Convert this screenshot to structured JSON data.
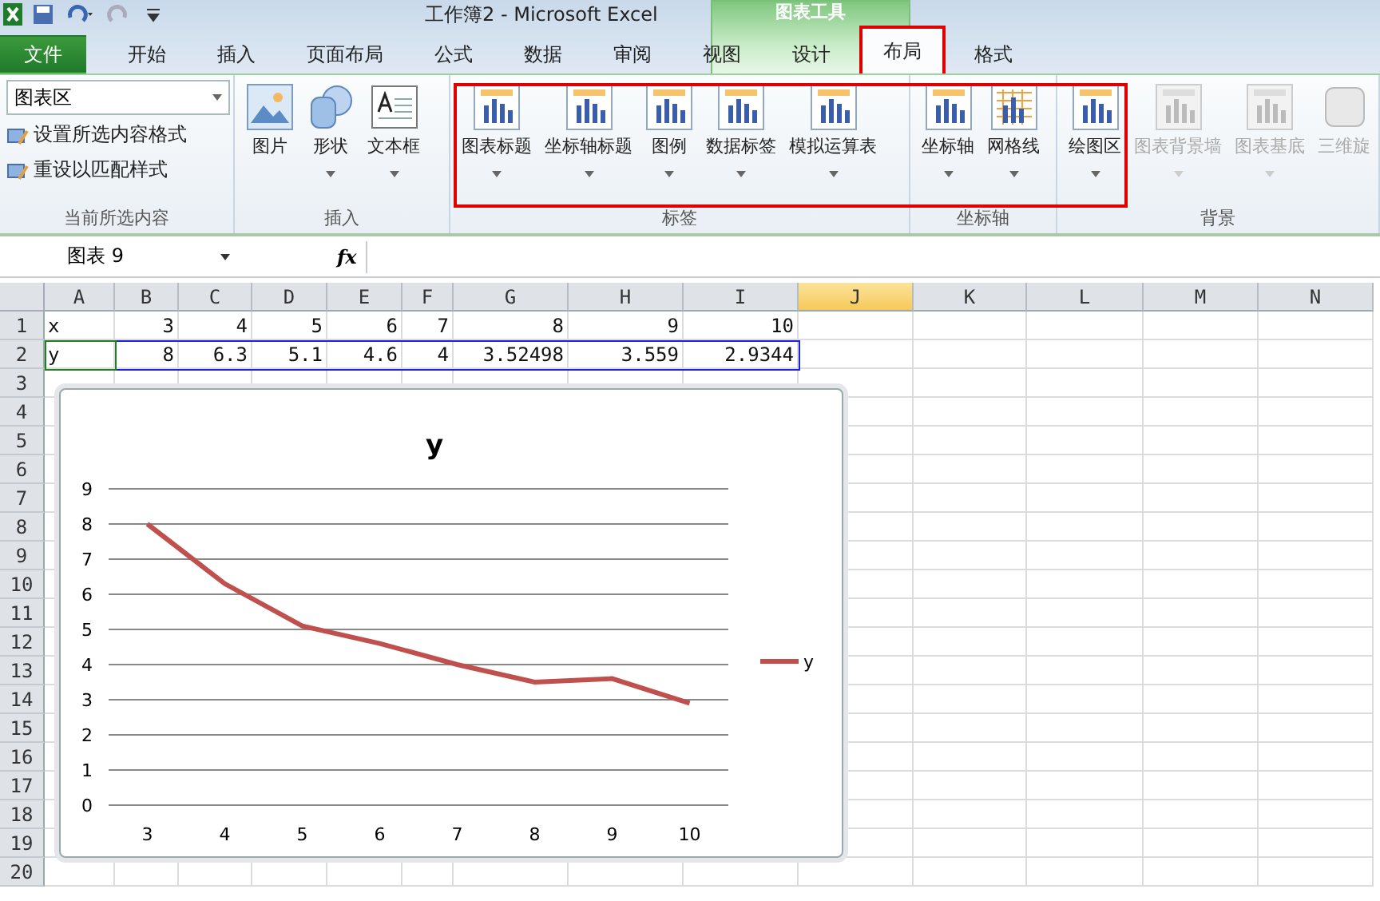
{
  "window": {
    "title": "工作簿2  -  Microsoft Excel",
    "context_group": "图表工具"
  },
  "tabs": [
    {
      "label": "文件",
      "kind": "file",
      "selected": false,
      "highlighted": false
    },
    {
      "label": "开始",
      "kind": "normal",
      "selected": false,
      "highlighted": false
    },
    {
      "label": "插入",
      "kind": "normal",
      "selected": false,
      "highlighted": false
    },
    {
      "label": "页面布局",
      "kind": "normal",
      "selected": false,
      "highlighted": false
    },
    {
      "label": "公式",
      "kind": "normal",
      "selected": false,
      "highlighted": false
    },
    {
      "label": "数据",
      "kind": "normal",
      "selected": false,
      "highlighted": false
    },
    {
      "label": "审阅",
      "kind": "normal",
      "selected": false,
      "highlighted": false
    },
    {
      "label": "视图",
      "kind": "normal",
      "selected": false,
      "highlighted": false
    },
    {
      "label": "设计",
      "kind": "context",
      "selected": false,
      "highlighted": false
    },
    {
      "label": "布局",
      "kind": "context",
      "selected": true,
      "highlighted": true
    },
    {
      "label": "格式",
      "kind": "context",
      "selected": false,
      "highlighted": false
    }
  ],
  "ribbon": {
    "highlight_box": true,
    "groups": [
      {
        "label": "当前所选内容",
        "selection": {
          "value": "图表区"
        },
        "actions": [
          {
            "label": "设置所选内容格式"
          },
          {
            "label": "重设以匹配样式"
          }
        ]
      },
      {
        "label": "插入",
        "items": [
          {
            "label": "图片",
            "dropdown": false,
            "disabled": false
          },
          {
            "label": "形状",
            "dropdown": true,
            "disabled": false
          },
          {
            "label": "文本框",
            "dropdown": true,
            "disabled": false
          }
        ]
      },
      {
        "label": "标签",
        "items": [
          {
            "label": "图表标题",
            "dropdown": true,
            "disabled": false
          },
          {
            "label": "坐标轴标题",
            "dropdown": true,
            "disabled": false
          },
          {
            "label": "图例",
            "dropdown": true,
            "disabled": false
          },
          {
            "label": "数据标签",
            "dropdown": true,
            "disabled": false
          },
          {
            "label": "模拟运算表",
            "dropdown": true,
            "disabled": false
          }
        ]
      },
      {
        "label": "坐标轴",
        "items": [
          {
            "label": "坐标轴",
            "dropdown": true,
            "disabled": false
          },
          {
            "label": "网格线",
            "dropdown": true,
            "disabled": false
          }
        ]
      },
      {
        "label": "背景",
        "items": [
          {
            "label": "绘图区",
            "dropdown": true,
            "disabled": false
          },
          {
            "label": "图表背景墙",
            "dropdown": true,
            "disabled": true
          },
          {
            "label": "图表基底",
            "dropdown": true,
            "disabled": true
          },
          {
            "label": "三维旋",
            "dropdown": false,
            "disabled": true
          }
        ]
      }
    ]
  },
  "formula_bar": {
    "name_box": "图表  9",
    "fx": "fx"
  },
  "sheet": {
    "columns": [
      {
        "label": "A",
        "selected": false
      },
      {
        "label": "B",
        "selected": false
      },
      {
        "label": "C",
        "selected": false
      },
      {
        "label": "D",
        "selected": false
      },
      {
        "label": "E",
        "selected": false
      },
      {
        "label": "F",
        "selected": false
      },
      {
        "label": "G",
        "selected": false
      },
      {
        "label": "H",
        "selected": false
      },
      {
        "label": "I",
        "selected": false
      },
      {
        "label": "J",
        "selected": true
      },
      {
        "label": "K",
        "selected": false
      },
      {
        "label": "L",
        "selected": false
      },
      {
        "label": "M",
        "selected": false
      },
      {
        "label": "N",
        "selected": false
      }
    ],
    "row_numbers": [
      "1",
      "2",
      "3",
      "4",
      "5",
      "6",
      "7",
      "8",
      "9",
      "10",
      "11",
      "12",
      "13",
      "14",
      "15",
      "16",
      "17",
      "18",
      "19",
      "20"
    ],
    "rows": [
      [
        "x",
        "3",
        "4",
        "5",
        "6",
        "7",
        "8",
        "9",
        "10"
      ],
      [
        "y",
        "8",
        "6.3",
        "5.1",
        "4.6",
        "4",
        "3.52498",
        "3.559",
        "2.9344"
      ]
    ]
  },
  "chart": {
    "chart_data": {
      "type": "line",
      "title": "y",
      "categories": [
        "3",
        "4",
        "5",
        "6",
        "7",
        "8",
        "9",
        "10"
      ],
      "series": [
        {
          "name": "y",
          "color": "#c0504d",
          "values": [
            8,
            6.3,
            5.1,
            4.6,
            4,
            3.5,
            3.6,
            2.9
          ]
        }
      ],
      "ylim": [
        0,
        9
      ],
      "yticks": [
        0,
        1,
        2,
        3,
        4,
        5,
        6,
        7,
        8,
        9
      ],
      "grid": true
    }
  }
}
